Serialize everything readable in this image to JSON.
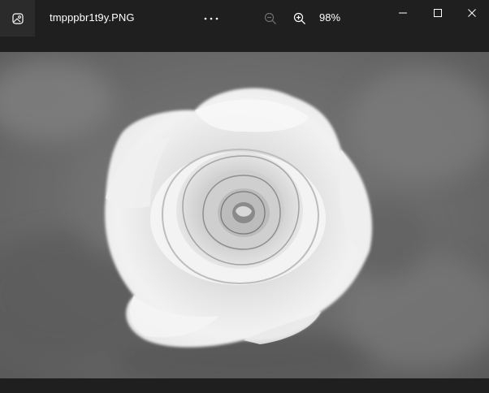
{
  "titlebar": {
    "filename": "tmpppbr1t9y.PNG",
    "more_label": "···",
    "zoom_level": "98%"
  },
  "icons": {
    "app": "photo-app-icon",
    "more": "more-options-icon",
    "zoom_out": "zoom-out-icon",
    "zoom_in": "zoom-in-icon",
    "minimize": "minimize-icon",
    "maximize": "maximize-icon",
    "close": "close-icon"
  },
  "colors": {
    "titlebar_bg": "#1f1f1f",
    "icon_box_bg": "#2b2b2b",
    "text": "#ffffff",
    "disabled_icon": "#7a7a7a"
  },
  "image": {
    "subject": "white rose on blurred green foliage background (grayscale)"
  }
}
